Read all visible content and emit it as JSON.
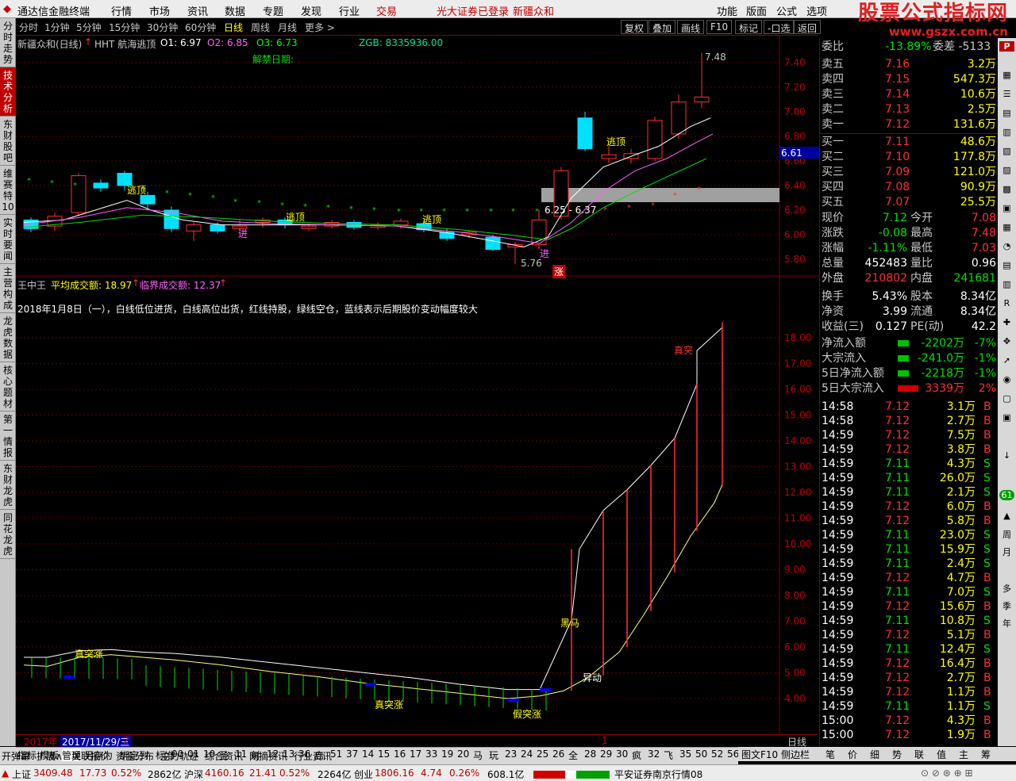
{
  "menubar": {
    "app_title": "通达信金融终端",
    "items": [
      "行情",
      "市场",
      "资讯",
      "数据",
      "专题",
      "发现",
      "行业",
      "交易"
    ],
    "broker_status": "光大证券已登录",
    "stock_name": "新疆众和",
    "right_items": [
      "功能",
      "版面",
      "公式",
      "选项"
    ],
    "watermark_line1": "股票公式指标网",
    "watermark_line2": "www.gszx.com.cn"
  },
  "left_tabs": [
    "分时走势",
    "技术分析",
    "东财股吧",
    "维赛特10",
    "实时要闻",
    "主营构成",
    "龙虎数据",
    "核心题材",
    "第一情报",
    "东财龙虎",
    "同花龙虎"
  ],
  "period_bar": {
    "items": [
      "分时",
      "1分钟",
      "5分钟",
      "15分钟",
      "30分钟",
      "60分钟",
      "日线",
      "周线",
      "月线",
      "更多 >"
    ],
    "selected": "日线",
    "buttons": [
      "复权",
      "叠加",
      "画线",
      "F10",
      "标记",
      "-口选",
      "返回"
    ]
  },
  "main_chart": {
    "title": "新疆众和(日线)",
    "indicator_name": "HHT 航海逃顶",
    "o1_label": "O1: 6.97",
    "o2_label": "O2: 6.85",
    "o3_label": "O3: 6.73",
    "zgb_label": "ZGB: 8335936.00",
    "unlock_label": "解禁日期:",
    "y_axis": [
      "7.40",
      "7.20",
      "7.00",
      "6.80",
      "6.60",
      "6.40",
      "6.20",
      "6.00",
      "5.80"
    ],
    "current_price_tag": "6.61",
    "high_label": "7.48",
    "low_label": "5.76",
    "range_label": "6.25 - 6.37",
    "markers": [
      "逃顶",
      "逃顶",
      "逃顶",
      "逃顶",
      "进",
      "进",
      "进",
      "涨"
    ]
  },
  "sub_chart": {
    "title": "王中王",
    "avg_label": "平均成交额: 18.97",
    "crit_label": "临界成交额: 12.37",
    "note": "2018年1月8日（一），白线低位进货，白线高位出货，红线持股，绿线空仓，蓝线表示后期股价变动幅度较大",
    "y_axis": [
      "18.00",
      "17.00",
      "16.00",
      "15.00",
      "14.00",
      "13.00",
      "12.00",
      "11.00",
      "10.00",
      "9.00",
      "8.00",
      "7.00",
      "6.00",
      "5.00",
      "4.00"
    ],
    "markers": [
      "真突涨",
      "真突涨",
      "假突涨",
      "黑马",
      "异动",
      "真突"
    ]
  },
  "bottom_axis": {
    "year": "2017年",
    "date": "2017/11/29/三",
    "digit2": "2",
    "digit1": "1",
    "period": "日线"
  },
  "tab_bar": [
    "指标",
    "模板",
    "管理",
    "另存为",
    "绑定到",
    "标准",
    "00",
    "01",
    "10",
    "圣",
    "11",
    "射",
    "12",
    "13",
    "36",
    "启",
    "51",
    "37",
    "14",
    "15",
    "16",
    "17",
    "33",
    "19",
    "20",
    "马",
    "玩",
    "23",
    "24",
    "25",
    "26",
    "全",
    "28",
    "29",
    "30",
    "疯",
    "32",
    "飞",
    "35",
    "50",
    "52",
    "56"
  ],
  "tab_bar_right": [
    "图文F10",
    "侧边栏",
    "笔",
    "价",
    "细",
    "势",
    "联",
    "值",
    "主",
    "筹"
  ],
  "tab_bar_lower": [
    "开弹幕",
    "扩展∧",
    "关联报价",
    "资金分布",
    "主力轨迹",
    "综合资讯",
    "网摘资讯",
    "行业资讯"
  ],
  "order_book": {
    "header_label": "委比",
    "header_value": "-13.89%",
    "header_extra": "委差 -5133",
    "sell": [
      {
        "label": "卖五",
        "price": "7.16",
        "vol": "3.2万"
      },
      {
        "label": "卖四",
        "price": "7.15",
        "vol": "547.3万"
      },
      {
        "label": "卖三",
        "price": "7.14",
        "vol": "10.6万"
      },
      {
        "label": "卖二",
        "price": "7.13",
        "vol": "2.5万"
      },
      {
        "label": "卖一",
        "price": "7.12",
        "vol": "131.6万"
      }
    ],
    "buy": [
      {
        "label": "买一",
        "price": "7.11",
        "vol": "48.6万"
      },
      {
        "label": "买二",
        "price": "7.10",
        "vol": "177.8万"
      },
      {
        "label": "买三",
        "price": "7.09",
        "vol": "121.0万"
      },
      {
        "label": "买四",
        "price": "7.08",
        "vol": "90.9万"
      },
      {
        "label": "买五",
        "price": "7.07",
        "vol": "25.5万"
      }
    ]
  },
  "quote": [
    {
      "l1": "现价",
      "v1": "7.12",
      "l2": "今开",
      "v2": "7.08"
    },
    {
      "l1": "涨跌",
      "v1": "-0.08",
      "l2": "最高",
      "v2": "7.48"
    },
    {
      "l1": "涨幅",
      "v1": "-1.11%",
      "l2": "最低",
      "v2": "7.03"
    },
    {
      "l1": "总量",
      "v1": "452483",
      "l2": "量比",
      "v2": "0.96"
    },
    {
      "l1": "外盘",
      "v1": "210802",
      "l2": "内盘",
      "v2": "241681"
    },
    {
      "l1": "换手",
      "v1": "5.43%",
      "l2": "股本",
      "v2": "8.34亿"
    },
    {
      "l1": "净资",
      "v1": "3.99",
      "l2": "流通",
      "v2": "8.34亿"
    },
    {
      "l1": "收益(三)",
      "v1": "0.127",
      "l2": "PE(动)",
      "v2": "42.2"
    }
  ],
  "flows": [
    {
      "label": "净流入额",
      "value": "-2202万",
      "pct": "-7%"
    },
    {
      "label": "大宗流入",
      "value": "-241.0万",
      "pct": "-1%"
    },
    {
      "label": "5日净流入额",
      "value": "-2218万",
      "pct": "-1%"
    },
    {
      "label": "5日大宗流入",
      "value": "3339万",
      "pct": "2%"
    }
  ],
  "ticks": [
    {
      "t": "14:58",
      "p": "7.12",
      "v": "3.1万",
      "d": "B"
    },
    {
      "t": "14:58",
      "p": "7.12",
      "v": "2.7万",
      "d": "B"
    },
    {
      "t": "14:59",
      "p": "7.12",
      "v": "7.5万",
      "d": "B"
    },
    {
      "t": "14:59",
      "p": "7.12",
      "v": "3.8万",
      "d": "B"
    },
    {
      "t": "14:59",
      "p": "7.11",
      "v": "4.3万",
      "d": "S"
    },
    {
      "t": "14:59",
      "p": "7.11",
      "v": "26.0万",
      "d": "S"
    },
    {
      "t": "14:59",
      "p": "7.11",
      "v": "2.1万",
      "d": "S"
    },
    {
      "t": "14:59",
      "p": "7.12",
      "v": "6.0万",
      "d": "B"
    },
    {
      "t": "14:59",
      "p": "7.12",
      "v": "5.8万",
      "d": "B"
    },
    {
      "t": "14:59",
      "p": "7.11",
      "v": "23.0万",
      "d": "S"
    },
    {
      "t": "14:59",
      "p": "7.11",
      "v": "15.9万",
      "d": "S"
    },
    {
      "t": "14:59",
      "p": "7.11",
      "v": "2.4万",
      "d": "S"
    },
    {
      "t": "14:59",
      "p": "7.12",
      "v": "4.7万",
      "d": "B"
    },
    {
      "t": "14:59",
      "p": "7.11",
      "v": "7.0万",
      "d": "S"
    },
    {
      "t": "14:59",
      "p": "7.12",
      "v": "15.6万",
      "d": "B"
    },
    {
      "t": "14:59",
      "p": "7.11",
      "v": "10.8万",
      "d": "S"
    },
    {
      "t": "14:59",
      "p": "7.12",
      "v": "5.1万",
      "d": "B"
    },
    {
      "t": "14:59",
      "p": "7.11",
      "v": "12.4万",
      "d": "S"
    },
    {
      "t": "14:59",
      "p": "7.12",
      "v": "16.4万",
      "d": "B"
    },
    {
      "t": "14:59",
      "p": "7.12",
      "v": "2.7万",
      "d": "B"
    },
    {
      "t": "14:59",
      "p": "7.12",
      "v": "1.1万",
      "d": "B"
    },
    {
      "t": "14:59",
      "p": "7.11",
      "v": "1.1万",
      "d": "S"
    },
    {
      "t": "15:00",
      "p": "7.12",
      "v": "4.3万",
      "d": "B"
    },
    {
      "t": "15:00",
      "p": "7.12",
      "v": "1.9万",
      "d": "B"
    }
  ],
  "right_side": [
    "P",
    "61",
    "周",
    "月",
    "多",
    "季",
    "年"
  ],
  "statusbar": {
    "sh_label": "上证",
    "sh_val": "3409.48",
    "sh_chg": "17.73",
    "sh_pct": "0.52%",
    "sh_amt": "2862亿",
    "hs_label": "沪深",
    "hs_val": "4160.16",
    "hs_chg": "21.41",
    "hs_pct": "0.52%",
    "hs_amt": "2264亿",
    "cy_label": "创业",
    "cy_val": "1806.16",
    "cy_chg": "4.74",
    "cy_pct": "0.26%",
    "cy_amt": "608.1亿",
    "server": "平安证券南京行情08"
  },
  "colors": {
    "up": "#ff3030",
    "down": "#00e000",
    "yellow": "#ffff00",
    "cyan": "#00e0ff",
    "grid": "#800000"
  }
}
